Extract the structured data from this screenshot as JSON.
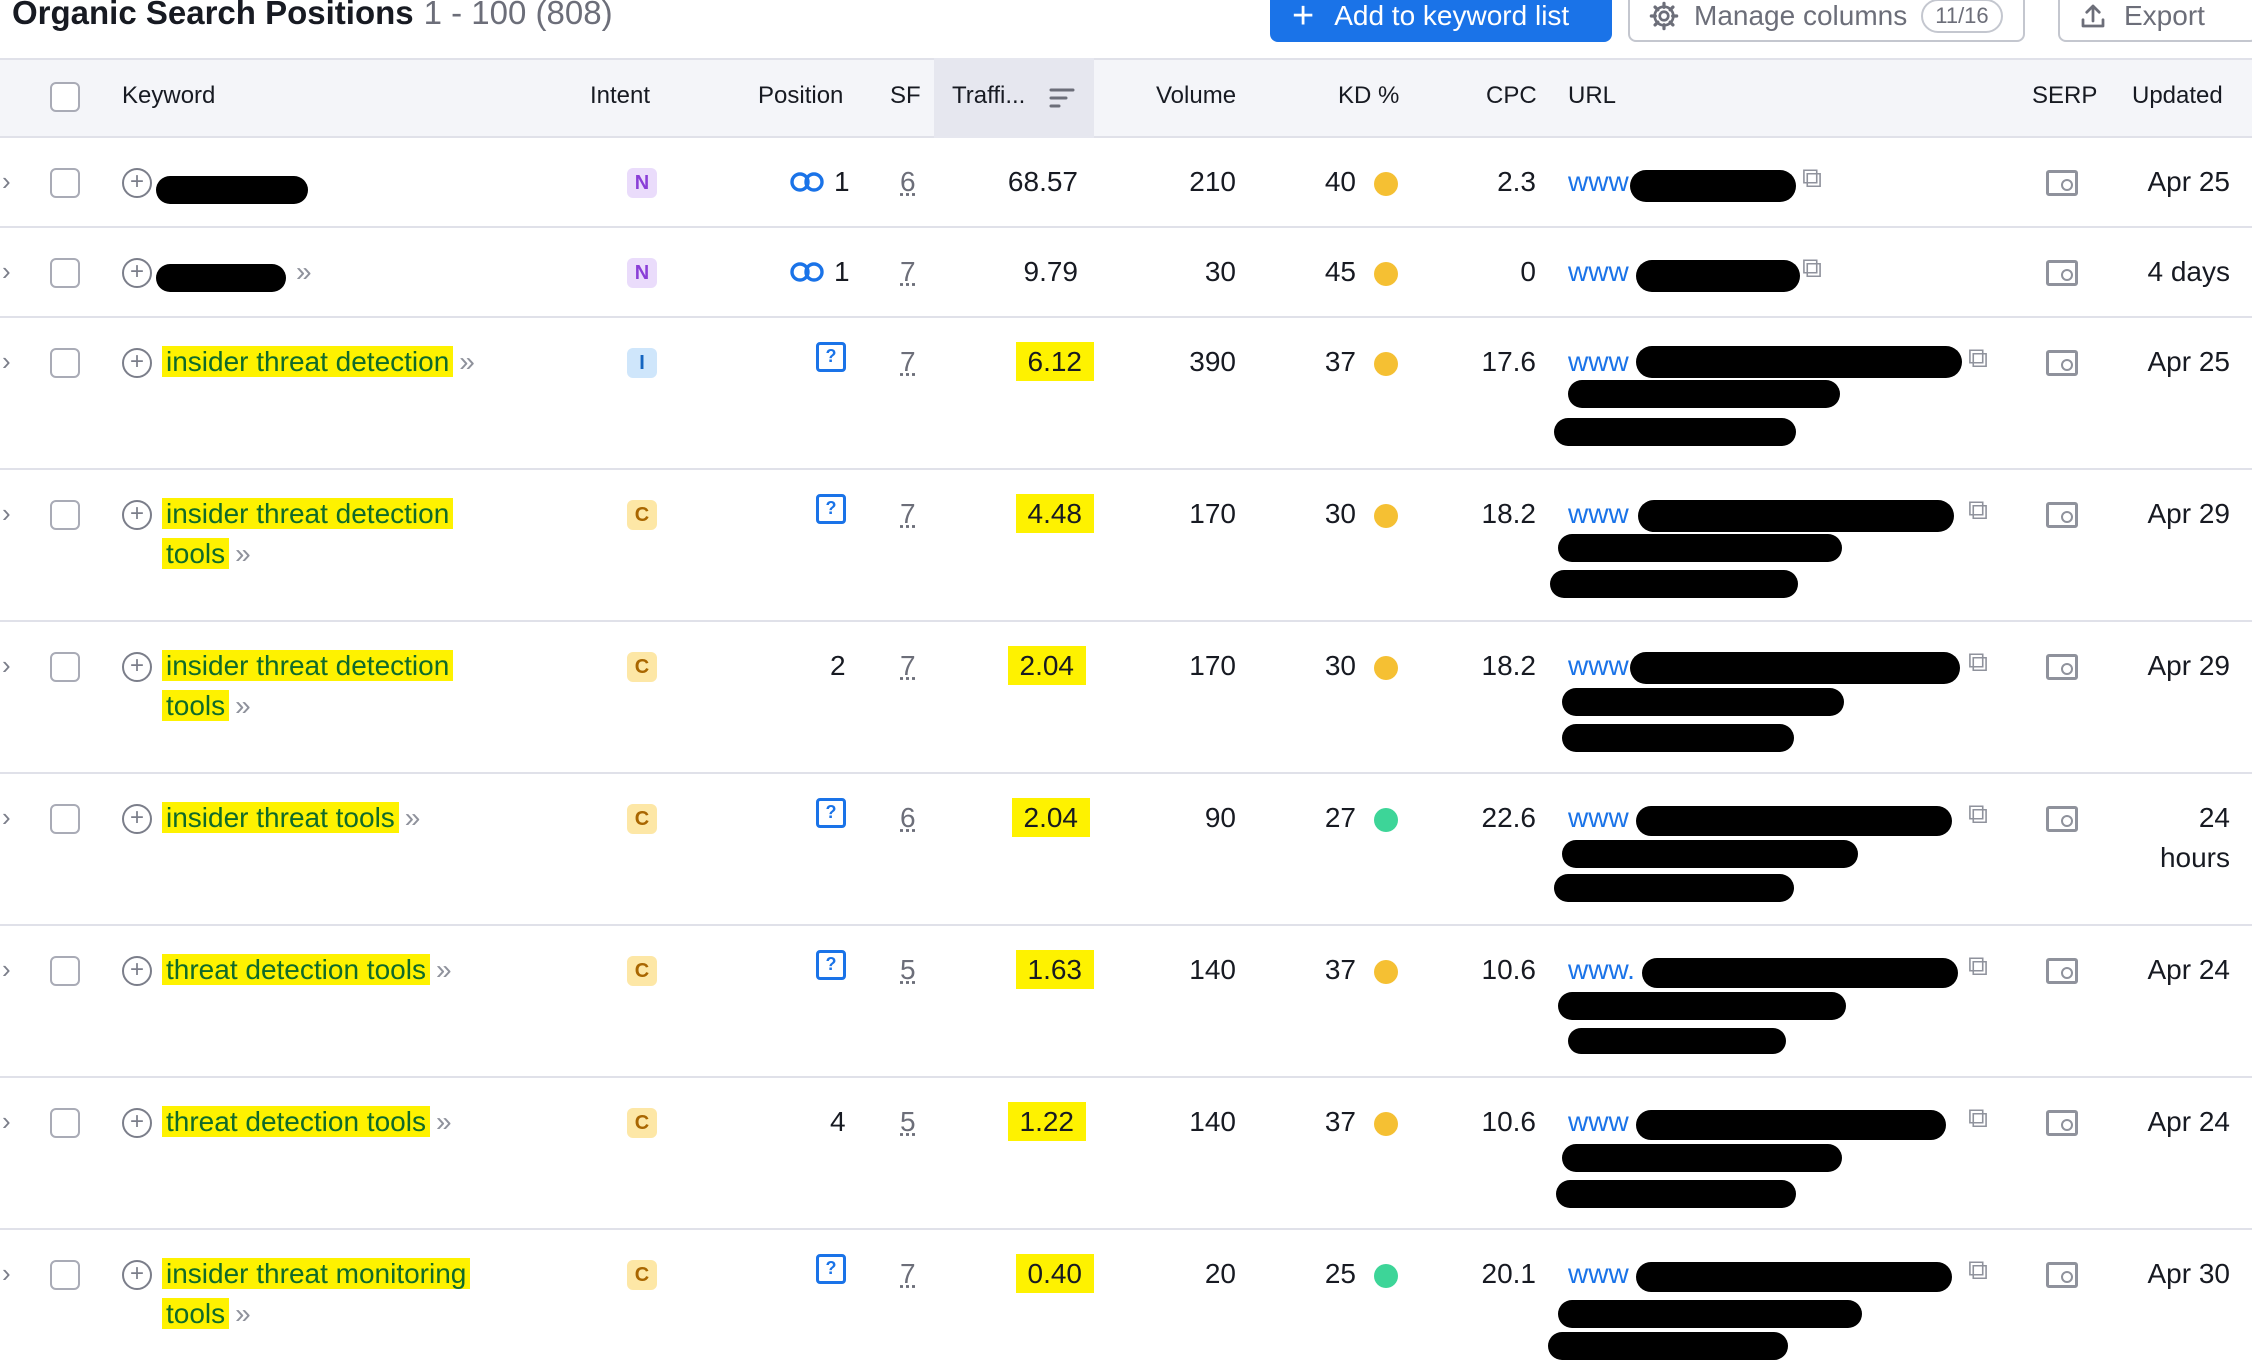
{
  "header": {
    "title": "Organic Search Positions",
    "range": "1 - 100 (808)",
    "add_button": "Add to keyword list",
    "manage_button": "Manage columns",
    "manage_badge": "11/16",
    "export_button": "Export"
  },
  "columns": {
    "keyword": "Keyword",
    "intent": "Intent",
    "position": "Position",
    "sf": "SF",
    "traffic": "Traffi...",
    "volume": "Volume",
    "kd": "KD %",
    "cpc": "CPC",
    "url": "URL",
    "serp": "SERP",
    "updated": "Updated"
  },
  "colors": {
    "kd_yellow": "#f5c033",
    "kd_green": "#3dd598",
    "highlight": "#fef200",
    "accent": "#1a73e8"
  },
  "rows": [
    {
      "kw1": "",
      "kw2": "",
      "intent": "N",
      "position": "1",
      "sf": "6",
      "traffic": "68.57",
      "volume": "210",
      "kd": "40",
      "cpc": "2.3",
      "url": "www",
      "updated1": "Apr 25",
      "updated2": ""
    },
    {
      "kw1": "",
      "kw2": "",
      "intent": "N",
      "position": "1",
      "sf": "7",
      "traffic": "9.79",
      "volume": "30",
      "kd": "45",
      "cpc": "0",
      "url": "www",
      "updated1": "4 days",
      "updated2": ""
    },
    {
      "kw1": "insider threat detection",
      "kw2": "",
      "intent": "I",
      "position": "",
      "sf": "7",
      "traffic": "6.12",
      "volume": "390",
      "kd": "37",
      "cpc": "17.6",
      "url": "www",
      "updated1": "Apr 25",
      "updated2": ""
    },
    {
      "kw1": "insider threat detection",
      "kw2": "tools",
      "intent": "C",
      "position": "",
      "sf": "7",
      "traffic": "4.48",
      "volume": "170",
      "kd": "30",
      "cpc": "18.2",
      "url": "www",
      "updated1": "Apr 29",
      "updated2": ""
    },
    {
      "kw1": "insider threat detection",
      "kw2": "tools",
      "intent": "C",
      "position": "2",
      "sf": "7",
      "traffic": "2.04",
      "volume": "170",
      "kd": "30",
      "cpc": "18.2",
      "url": "www",
      "updated1": "Apr 29",
      "updated2": ""
    },
    {
      "kw1": "insider threat tools",
      "kw2": "",
      "intent": "C",
      "position": "",
      "sf": "6",
      "traffic": "2.04",
      "volume": "90",
      "kd": "27",
      "cpc": "22.6",
      "url": "www",
      "updated1": "24",
      "updated2": "hours"
    },
    {
      "kw1": "threat detection tools",
      "kw2": "",
      "intent": "C",
      "position": "",
      "sf": "5",
      "traffic": "1.63",
      "volume": "140",
      "kd": "37",
      "cpc": "10.6",
      "url": "www.",
      "updated1": "Apr 24",
      "updated2": ""
    },
    {
      "kw1": "threat detection tools",
      "kw2": "",
      "intent": "C",
      "position": "4",
      "sf": "5",
      "traffic": "1.22",
      "volume": "140",
      "kd": "37",
      "cpc": "10.6",
      "url": "www",
      "updated1": "Apr 24",
      "updated2": ""
    },
    {
      "kw1": "insider threat monitoring",
      "kw2": "tools",
      "intent": "C",
      "position": "",
      "sf": "7",
      "traffic": "0.40",
      "volume": "20",
      "kd": "25",
      "cpc": "20.1",
      "url": "www",
      "updated1": "Apr 30",
      "updated2": ""
    }
  ]
}
